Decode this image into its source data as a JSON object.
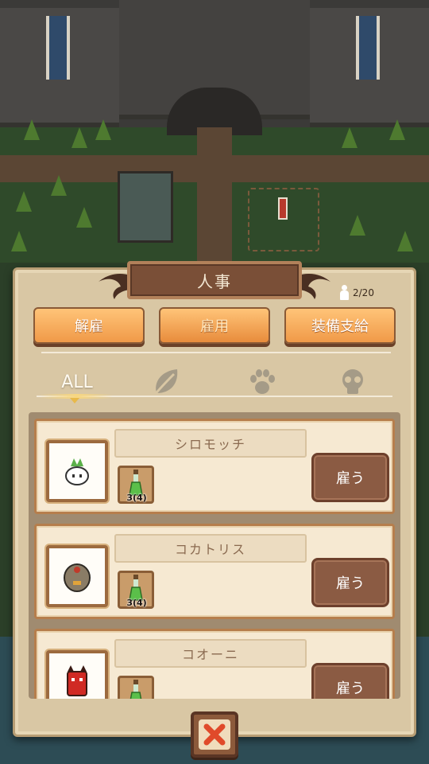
{
  "dialog": {
    "title": "人事",
    "staff_count": "2/20",
    "tabs": [
      {
        "label": "解雇"
      },
      {
        "label": "雇用"
      },
      {
        "label": "装備支給"
      }
    ],
    "filters": {
      "all_label": "ALL",
      "icons": [
        "leaf-icon",
        "paw-icon",
        "skull-icon"
      ],
      "active": "ALL"
    },
    "monsters": [
      {
        "name": "シロモッチ",
        "item_count": "3(4)",
        "hire_label": "雇う",
        "portrait": "white-mochi-icon"
      },
      {
        "name": "コカトリス",
        "item_count": "3(4)",
        "hire_label": "雇う",
        "portrait": "cockatrice-egg-icon"
      },
      {
        "name": "コオーニ",
        "item_count": "",
        "hire_label": "雇う",
        "portrait": "red-oni-icon"
      }
    ],
    "close_icon": "close-x-icon"
  },
  "colors": {
    "panel": "#d9c7a4",
    "title_plate": "#7a4f37",
    "tab_button": "#f09a48",
    "hire_button": "#8b5b43",
    "close_x": "#e04a2a"
  }
}
